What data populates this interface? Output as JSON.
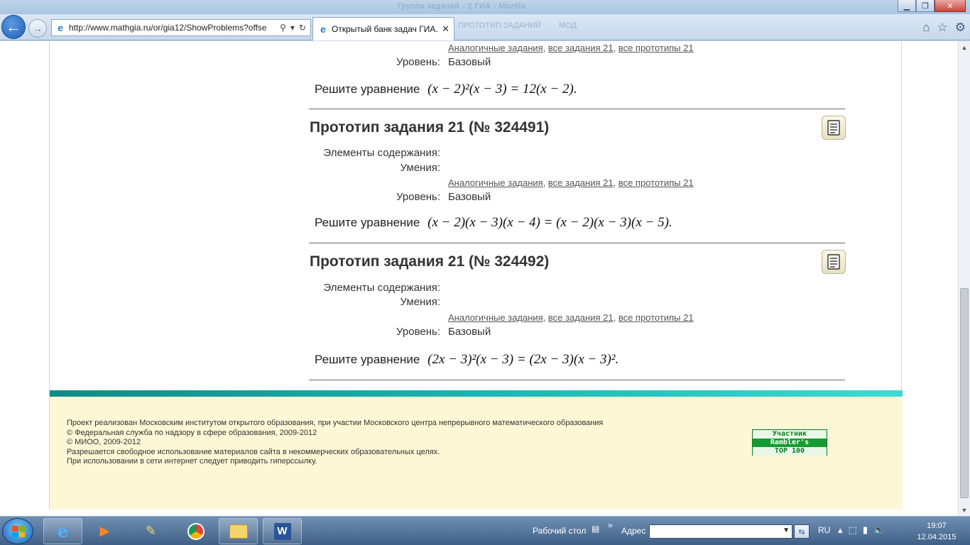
{
  "browser": {
    "window_caption": "Группа заданий - 2 ГИА - Mozilla",
    "url": "http://www.mathgia.ru/or/gia12/ShowProblems?offse",
    "tab_title": "Открытый банк задач ГИА...",
    "ghost_tab_1": "ПРОТОТИП ЗАДАНИЙ",
    "ghost_tab_2": "МОД"
  },
  "top_partial": {
    "links": [
      "Аналогичные задания",
      "все задания 21",
      "все прототипы 21"
    ],
    "level_label": "Уровень:",
    "level_value": "Базовый",
    "problem_prefix": "Решите уравнение",
    "equation": "(x − 2)²(x − 3) = 12(x − 2)."
  },
  "prototypes": [
    {
      "title": "Прототип задания 21 (№ 324491)",
      "content_label": "Элементы содержания:",
      "skills_label": "Умения:",
      "links": [
        "Аналогичные задания",
        "все задания 21",
        "все прототипы 21"
      ],
      "level_label": "Уровень:",
      "level_value": "Базовый",
      "problem_prefix": "Решите уравнение",
      "equation": "(x − 2)(x − 3)(x − 4) = (x − 2)(x − 3)(x − 5)."
    },
    {
      "title": "Прототип задания 21 (№ 324492)",
      "content_label": "Элементы содержания:",
      "skills_label": "Умения:",
      "links": [
        "Аналогичные задания",
        "все задания 21",
        "все прототипы 21"
      ],
      "level_label": "Уровень:",
      "level_value": "Базовый",
      "problem_prefix": "Решите уравнение",
      "equation": "(2x − 3)²(x − 3) = (2x − 3)(x − 3)²."
    }
  ],
  "footer": {
    "lines": [
      "Проект реализован Московским институтом открытого образования, при участии Московского центра непрерывного математического образования",
      "© Федеральная служба по надзору в сфере образования, 2009-2012",
      "© МИОО, 2009-2012",
      "Разрешается свободное использование материалов сайта в некоммерческих образовательных целях.",
      "При использовании в сети интернет следует приводить гиперссылку."
    ],
    "rambler": [
      "Участник",
      "Rambler's",
      "TOP 100"
    ]
  },
  "taskbar": {
    "desktop_label": "Рабочий стол",
    "chevron": "»",
    "address_label": "Адрес",
    "lang": "RU",
    "time": "19:07",
    "date": "12.04.2015",
    "word_label": "W"
  },
  "colors": {
    "footer_band": "#1ab5b2",
    "footer_bg": "#fdf7d5",
    "rambler_green": "#159b31"
  }
}
